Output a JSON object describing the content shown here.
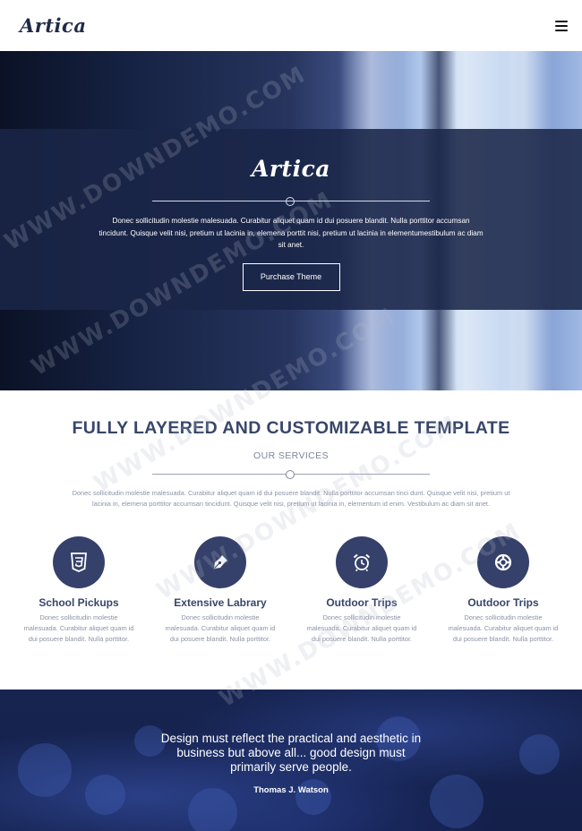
{
  "header": {
    "logo": "Artica",
    "menu_icon": "hamburger-icon"
  },
  "hero": {
    "logo": "Artica",
    "text": "Donec sollicitudin molestie malesuada. Curabitur aliquet quam id dui posuere blandit. Nulla porttitor accumsan tincidunt. Quisque velit nisi, pretium ut lacinia in, elemena porttit nisi, pretium ut lacinia in elementumestibulum ac diam sit anet.",
    "button": "Purchase Theme"
  },
  "services": {
    "title": "FULLY LAYERED AND CUSTOMIZABLE TEMPLATE",
    "subtitle": "OUR SERVICES",
    "intro": "Donec sollicitudin molestie malesuada. Curabitur aliquet quam id dui posuere blandit. Nulla porttitor accumsan tinci dunt. Quisque velit nisi, pretium ut lacinia in, elemena porttitor accumsan tincidunt. Quisque velit nisi, pretium ut lacinia in, elementum id enim. Vestibulum ac diam sit anet.",
    "items": [
      {
        "title": "School Pickups",
        "text": "Donec sollicitudin molestie malesuada. Curabitur aliquet quam id dui posuere blandit. Nulla porttitor.",
        "icon": "css3-icon"
      },
      {
        "title": "Extensive Labrary",
        "text": "Donec sollicitudin molestie malesuada. Curabitur aliquet quam id dui posuere blandit. Nulla porttitor.",
        "icon": "pen-nib-icon"
      },
      {
        "title": "Outdoor Trips",
        "text": "Donec sollicitudin molestie malesuada. Curabitur aliquet quam id dui posuere blandit. Nulla porttitor.",
        "icon": "alarm-clock-icon"
      },
      {
        "title": "Outdoor Trips",
        "text": "Donec sollicitudin molestie malesuada. Curabitur aliquet quam id dui posuere blandit. Nulla porttitor.",
        "icon": "life-ring-icon"
      }
    ]
  },
  "quote": {
    "text": "Design must reflect the practical and aesthetic in business but above all... good design must primarily serve people.",
    "author": "Thomas J. Watson"
  },
  "watermark": "WWW.DOWNDEMO.COM",
  "colors": {
    "primary": "#35416a",
    "hero_band": "#1a2648",
    "quote_bg": "#172450"
  }
}
